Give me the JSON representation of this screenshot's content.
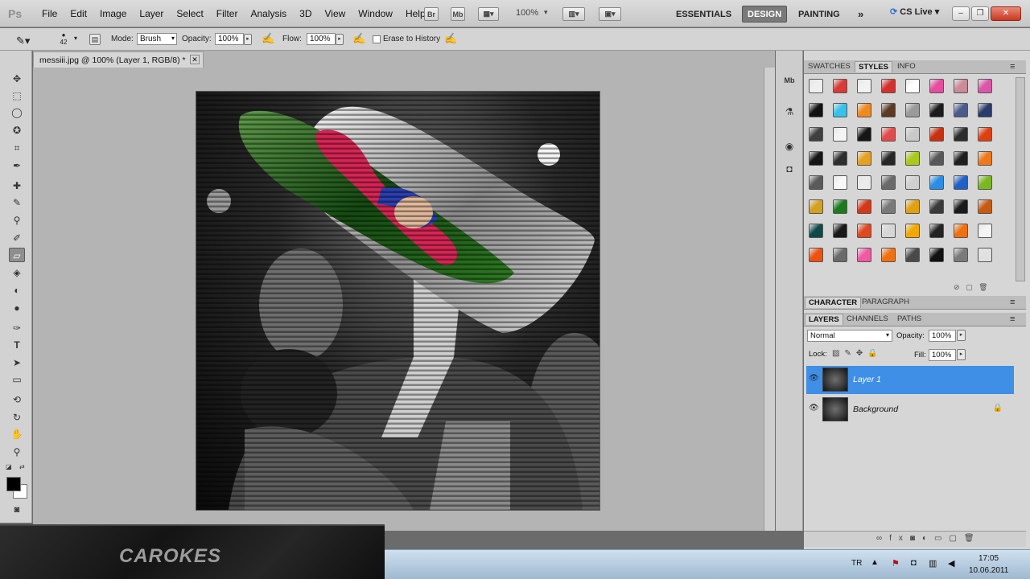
{
  "app": {
    "logo": "Ps",
    "doc_tab": "messiii.jpg @ 100% (Layer 1, RGB/8) *",
    "zoom": "100%"
  },
  "menu": [
    "File",
    "Edit",
    "Image",
    "Layer",
    "Select",
    "Filter",
    "Analysis",
    "3D",
    "View",
    "Window",
    "Help"
  ],
  "mini_buttons": {
    "bridge": "Br",
    "mini_bridge": "Mb"
  },
  "workspaces": {
    "essentials": "ESSENTIALS",
    "design": "DESIGN",
    "painting": "PAINTING",
    "more": "»",
    "cslive": "CS Live"
  },
  "options": {
    "brush_size": "42",
    "mode_label": "Mode:",
    "mode_value": "Brush",
    "opacity_label": "Opacity:",
    "opacity_value": "100%",
    "flow_label": "Flow:",
    "flow_value": "100%",
    "erase_history": "Erase to History"
  },
  "panels": {
    "top_tabs": [
      "SWATCHES",
      "STYLES",
      "INFO"
    ],
    "mid_tabs": [
      "CHARACTER",
      "PARAGRAPH"
    ],
    "layer_tabs": [
      "LAYERS",
      "CHANNELS",
      "PATHS"
    ],
    "blend_mode": "Normal",
    "opacity_label": "Opacity:",
    "opacity_value": "100%",
    "lock_label": "Lock:",
    "fill_label": "Fill:",
    "fill_value": "100%"
  },
  "layers": [
    {
      "name": "Layer 1",
      "selected": true
    },
    {
      "name": "Background",
      "locked": true
    }
  ],
  "style_colors": [
    "#efefef",
    "#d93a35",
    "#f2f2f2",
    "#d43030",
    "#ffffff",
    "#e64ca0",
    "#cc8a9a",
    "#dd55aa",
    "#111111",
    "#35c1ea",
    "#f08a20",
    "#5c3a24",
    "#9a9a9a",
    "#1b1b1b",
    "#4a5a8a",
    "#2a3a6a",
    "#404040",
    "#f4f4f4",
    "#161616",
    "#e24b4b",
    "#c9c9c9",
    "#c83010",
    "#2c2c2c",
    "#e04010",
    "#151515",
    "#2e2e2e",
    "#e6a020",
    "#262626",
    "#a9c91b",
    "#585858",
    "#1f1f1f",
    "#f07818",
    "#5a5a5a",
    "#f8f8f8",
    "#ebebeb",
    "#6a6a6a",
    "#d0d0d0",
    "#2a8ee6",
    "#2060c8",
    "#7ab820",
    "#d4a020",
    "#1c7a1c",
    "#d43818",
    "#797979",
    "#e0a010",
    "#3a3a3a",
    "#1a1a1a",
    "#c85a10",
    "#0e4a4a",
    "#181818",
    "#e04820",
    "#d6d6d6",
    "#f2a800",
    "#232323",
    "#f07010",
    "#f4f4f4",
    "#f05010",
    "#6a6a6a",
    "#f05aa0",
    "#f07010",
    "#4a4a4a",
    "#121212",
    "#7a7a7a",
    "#e0e0e0"
  ],
  "watermark": "CAROKES",
  "taskbar": {
    "lang": "TR",
    "time": "17:05",
    "date": "10.06.2011"
  }
}
